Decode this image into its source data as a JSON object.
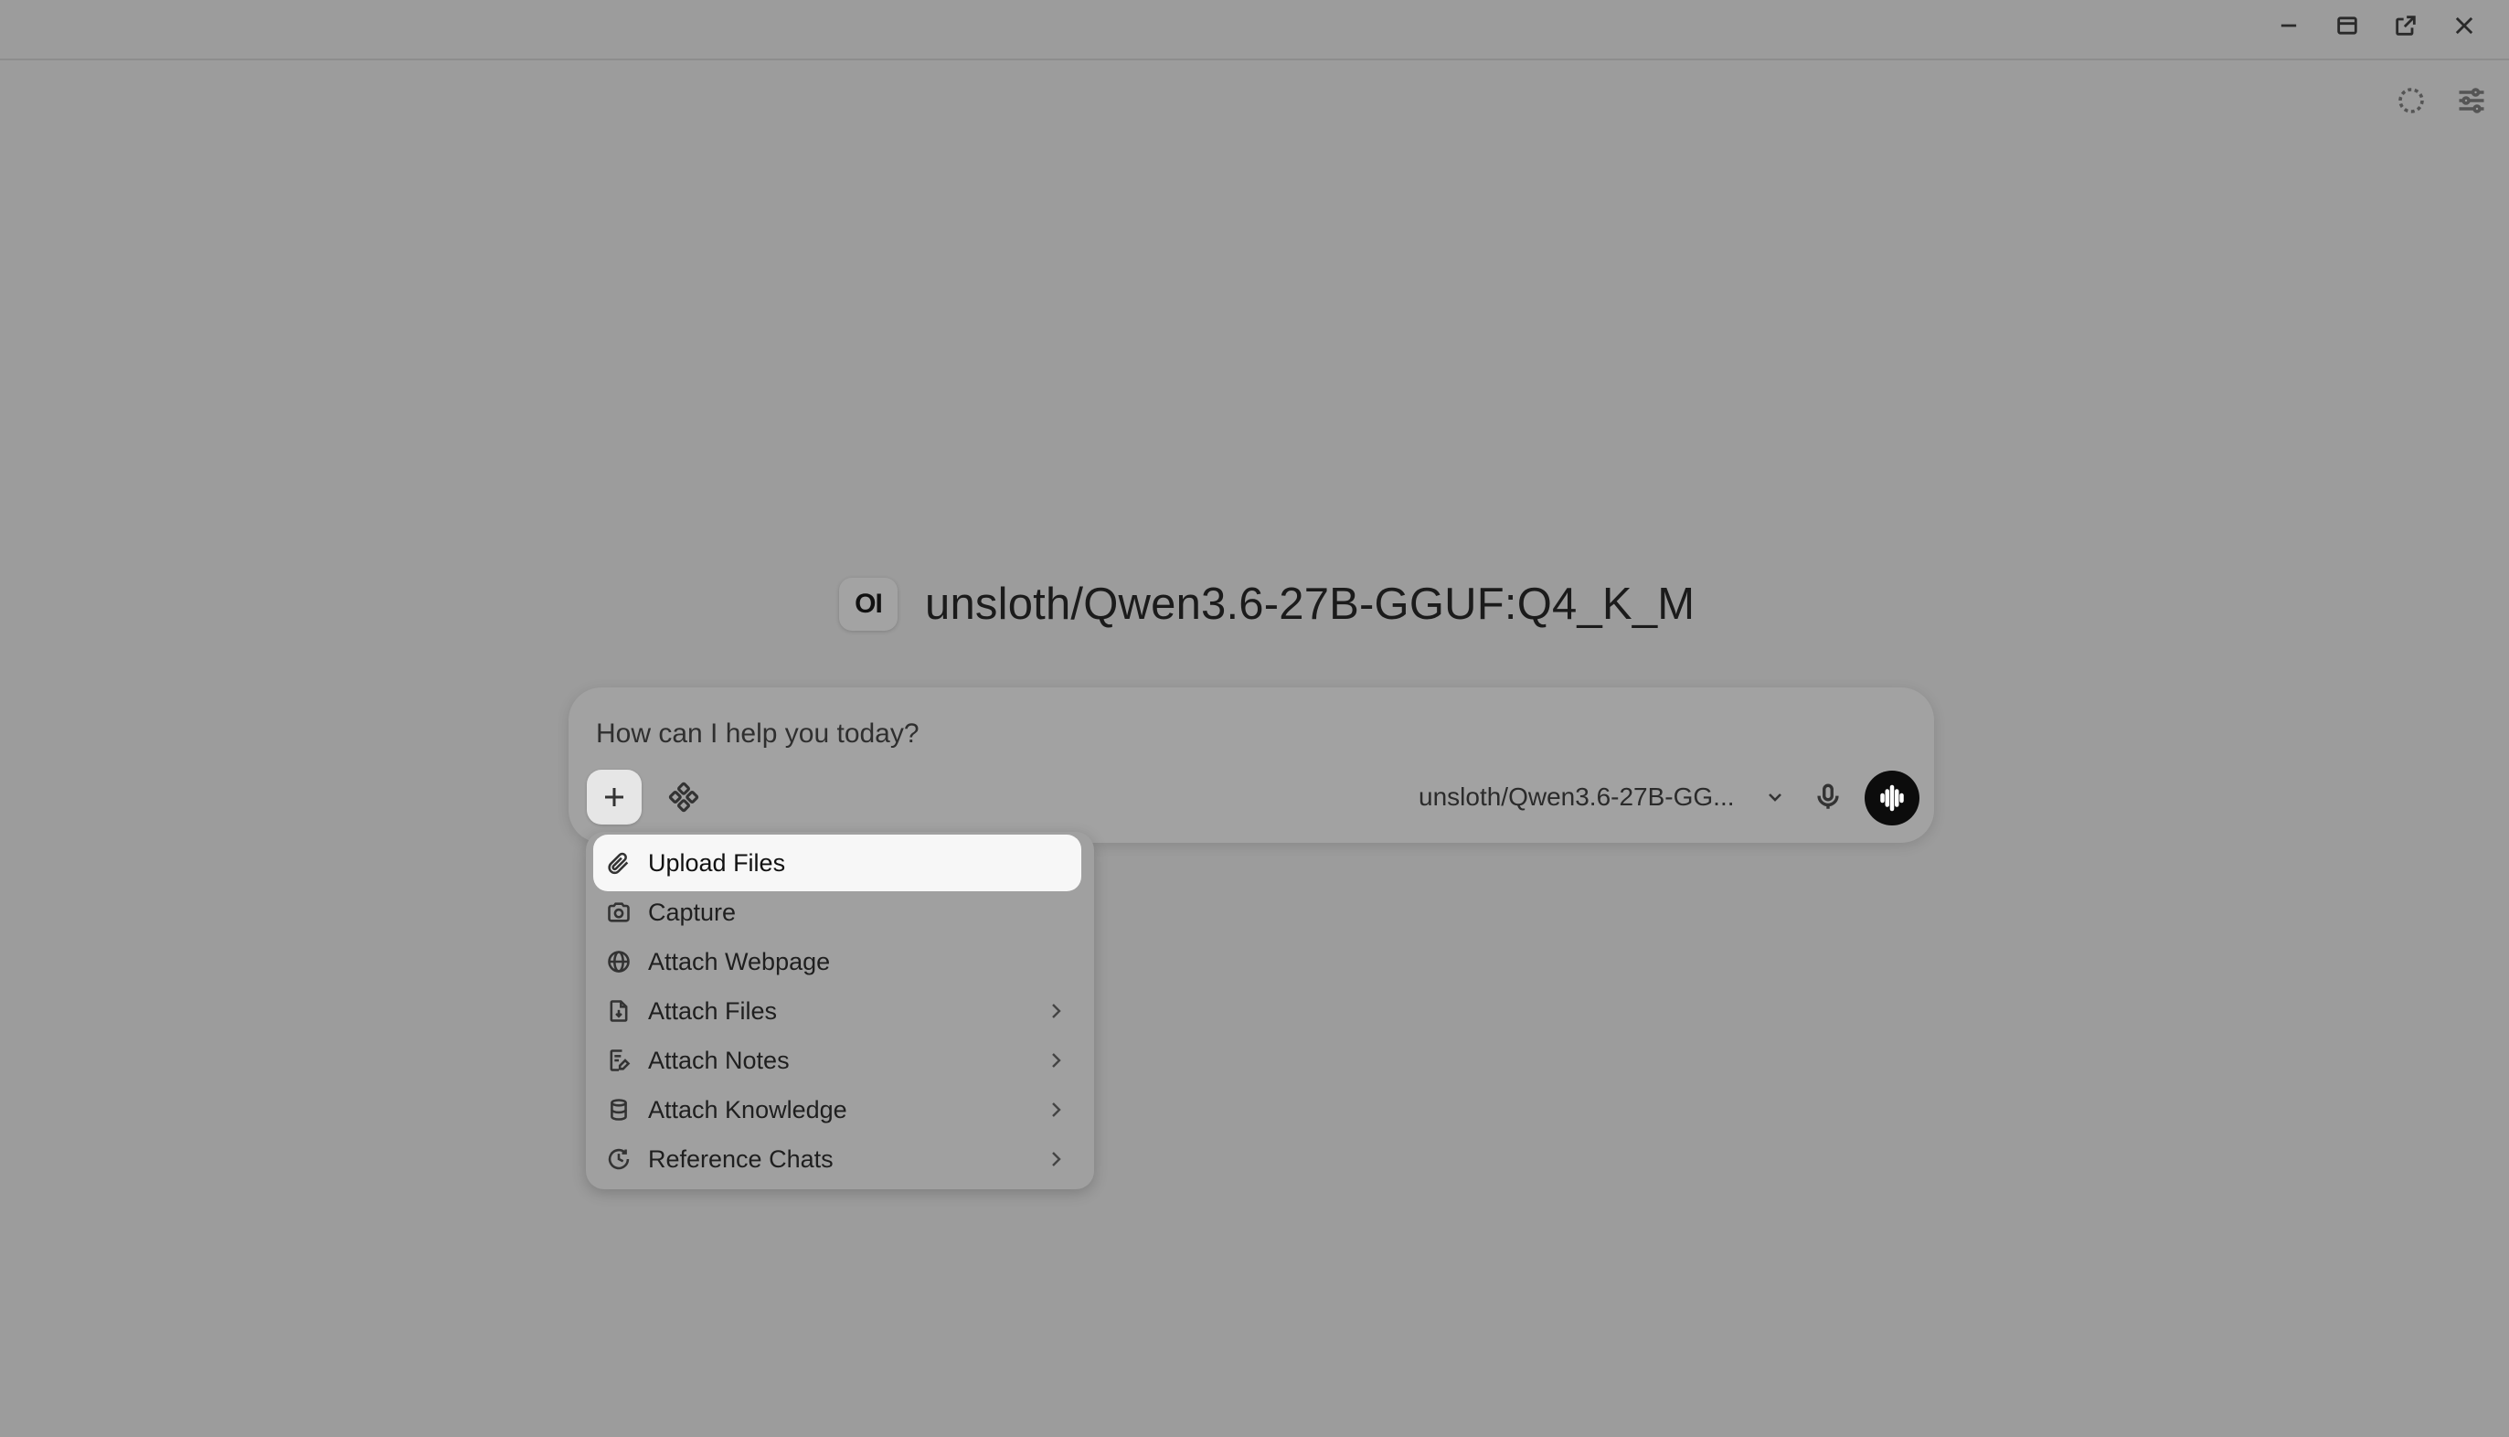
{
  "window": {
    "controls": [
      "minimize-icon",
      "maximize-icon",
      "popout-icon",
      "close-icon"
    ]
  },
  "toolbar": {
    "icons": [
      "loading-circle-icon",
      "settings-sliders-icon"
    ]
  },
  "hero": {
    "logo_text": "OI",
    "model_title": "unsloth/Qwen3.6-27B-GGUF:Q4_K_M"
  },
  "composer": {
    "placeholder": "How can I help you today?",
    "selected_model": "unsloth/Qwen3.6-27B-GG..."
  },
  "menu": {
    "items": [
      {
        "label": "Upload Files",
        "icon": "paperclip-icon",
        "has_submenu": false
      },
      {
        "label": "Capture",
        "icon": "camera-icon",
        "has_submenu": false
      },
      {
        "label": "Attach Webpage",
        "icon": "globe-icon",
        "has_submenu": false
      },
      {
        "label": "Attach Files",
        "icon": "file-icon",
        "has_submenu": true
      },
      {
        "label": "Attach Notes",
        "icon": "note-icon",
        "has_submenu": true
      },
      {
        "label": "Attach Knowledge",
        "icon": "database-icon",
        "has_submenu": true
      },
      {
        "label": "Reference Chats",
        "icon": "history-icon",
        "has_submenu": true
      }
    ]
  }
}
